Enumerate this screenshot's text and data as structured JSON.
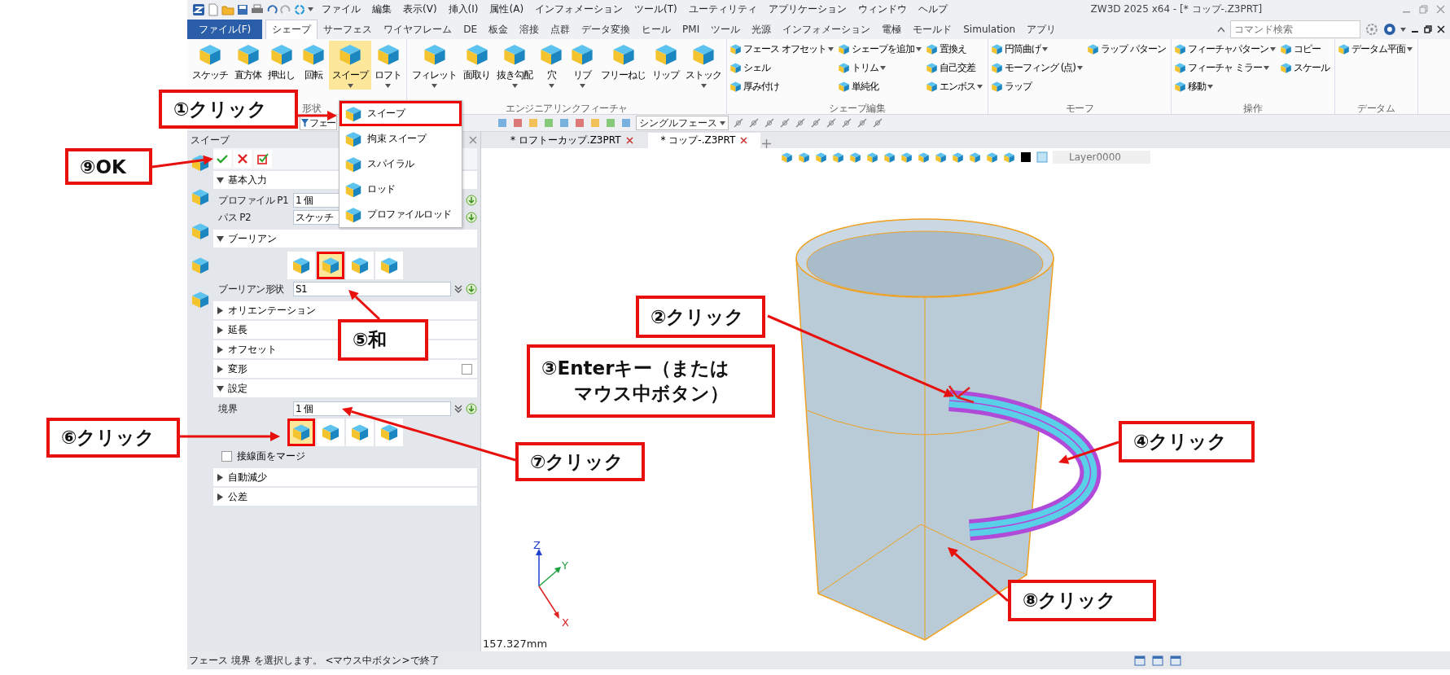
{
  "title_bar": {
    "menu": [
      "ファイル",
      "編集",
      "表示(V)",
      "挿入(I)",
      "属性(A)",
      "インフォメーション",
      "ツール(T)",
      "ユーティリティ",
      "アプリケーション",
      "ウィンドウ",
      "ヘルプ"
    ],
    "title": "ZW3D 2025 x64 - [* コップ-.Z3PRT]"
  },
  "ribbon_tabs": [
    {
      "label": "ファイル(F)",
      "kind": "file",
      "selected": false
    },
    {
      "label": "シェープ",
      "kind": "tab",
      "selected": true
    },
    {
      "label": "サーフェス",
      "kind": "tab",
      "selected": false
    },
    {
      "label": "ワイヤフレーム",
      "kind": "tab",
      "selected": false
    },
    {
      "label": "DE",
      "kind": "tab",
      "selected": false
    },
    {
      "label": "板金",
      "kind": "tab",
      "selected": false
    },
    {
      "label": "溶接",
      "kind": "tab",
      "selected": false
    },
    {
      "label": "点群",
      "kind": "tab",
      "selected": false
    },
    {
      "label": "データ変換",
      "kind": "tab",
      "selected": false
    },
    {
      "label": "ヒール",
      "kind": "tab",
      "selected": false
    },
    {
      "label": "PMI",
      "kind": "tab",
      "selected": false
    },
    {
      "label": "ツール",
      "kind": "tab",
      "selected": false
    },
    {
      "label": "光源",
      "kind": "tab",
      "selected": false
    },
    {
      "label": "インフォメーション",
      "kind": "tab",
      "selected": false
    },
    {
      "label": "電極",
      "kind": "tab",
      "selected": false
    },
    {
      "label": "モールド",
      "kind": "tab",
      "selected": false
    },
    {
      "label": "Simulation",
      "kind": "tab",
      "selected": false
    },
    {
      "label": "アプリ",
      "kind": "tab",
      "selected": false
    }
  ],
  "command_search": {
    "placeholder": "コマンド検索"
  },
  "ribbon_groups": [
    {
      "kind": "large",
      "label": "形状",
      "items": [
        {
          "label": "スケッチ",
          "dropdown": false,
          "selected": false
        },
        {
          "label": "直方体",
          "dropdown": false,
          "selected": false
        },
        {
          "label": "押出し",
          "dropdown": false,
          "selected": false
        },
        {
          "label": "回転",
          "dropdown": false,
          "selected": false
        },
        {
          "label": "スイープ",
          "dropdown": true,
          "selected": true
        },
        {
          "label": "ロフト",
          "dropdown": true,
          "selected": false
        }
      ]
    },
    {
      "kind": "large",
      "label": "エンジニアリンクフィーチャ",
      "items": [
        {
          "label": "フィレット",
          "dropdown": true,
          "selected": false
        },
        {
          "label": "面取り",
          "dropdown": false,
          "selected": false
        },
        {
          "label": "抜き勾配",
          "dropdown": true,
          "selected": false
        },
        {
          "label": "穴",
          "dropdown": true,
          "selected": false
        },
        {
          "label": "リブ",
          "dropdown": true,
          "selected": false
        },
        {
          "label": "フリーねじ",
          "dropdown": false,
          "selected": false
        },
        {
          "label": "リップ",
          "dropdown": false,
          "selected": false
        },
        {
          "label": "ストック",
          "dropdown": true,
          "selected": false
        }
      ]
    },
    {
      "kind": "small",
      "label": "シェープ編集",
      "columns": [
        [
          {
            "label": "フェース オフセット",
            "dropdown": true
          },
          {
            "label": "シェル",
            "dropdown": false
          },
          {
            "label": "厚み付け",
            "dropdown": false
          }
        ],
        [
          {
            "label": "シェープを追加",
            "dropdown": true
          },
          {
            "label": "トリム",
            "dropdown": true
          },
          {
            "label": "単純化",
            "dropdown": false
          }
        ],
        [
          {
            "label": "置換え",
            "dropdown": false
          },
          {
            "label": "自己交差",
            "dropdown": false
          },
          {
            "label": "エンボス",
            "dropdown": true
          }
        ]
      ]
    },
    {
      "kind": "small",
      "label": "モーフ",
      "columns": [
        [
          {
            "label": "円筒曲げ",
            "dropdown": true
          },
          {
            "label": "モーフィング (点)",
            "dropdown": true
          },
          {
            "label": "ラップ",
            "dropdown": false
          }
        ],
        [
          {
            "label": "ラップ パターン",
            "dropdown": false
          }
        ]
      ]
    },
    {
      "kind": "small",
      "label": "操作",
      "columns": [
        [
          {
            "label": "フィーチャパターン",
            "dropdown": true
          },
          {
            "label": "フィーチャ ミラー",
            "dropdown": true
          },
          {
            "label": "移動",
            "dropdown": true
          }
        ],
        [
          {
            "label": "コピー",
            "dropdown": false
          },
          {
            "label": "スケール",
            "dropdown": false
          }
        ]
      ]
    },
    {
      "kind": "small",
      "label": "データム",
      "columns": [
        [
          {
            "label": "データム平面",
            "dropdown": true
          }
        ]
      ]
    }
  ],
  "selection_toolbar": {
    "filter": "フェー",
    "pick_mode": "シングルフェース"
  },
  "panel": {
    "title": "スイープ",
    "sections": [
      {
        "label": "基本入力",
        "expanded": true,
        "rows": [
          {
            "label": "プロファイル P1",
            "value": "1 個"
          },
          {
            "label": "パス P2",
            "value": "スケッチ"
          }
        ]
      },
      {
        "label": "ブーリアン",
        "expanded": true,
        "options": [
          {
            "selected": false,
            "annotated": false
          },
          {
            "selected": true,
            "annotated": true
          },
          {
            "selected": false,
            "annotated": false
          },
          {
            "selected": false,
            "annotated": false
          }
        ],
        "rows": [
          {
            "label": "ブーリアン形状",
            "value": "S1"
          }
        ]
      },
      {
        "label": "オリエンテーション",
        "expanded": false
      },
      {
        "label": "延長",
        "expanded": false
      },
      {
        "label": "オフセット",
        "expanded": false
      },
      {
        "label": "変形",
        "expanded": false,
        "toggle": {
          "checked": false
        }
      },
      {
        "label": "設定",
        "expanded": true,
        "rows": [
          {
            "label": "境界",
            "value": "1 個"
          }
        ],
        "options": [
          {
            "selected": true,
            "annotated": true
          },
          {
            "selected": false,
            "annotated": false
          },
          {
            "selected": false,
            "annotated": false
          },
          {
            "selected": false,
            "annotated": false
          }
        ],
        "check_rows": [
          {
            "label": "接線面をマージ",
            "checked": false
          }
        ]
      },
      {
        "label": "自動減少",
        "expanded": false
      },
      {
        "label": "公差",
        "expanded": false
      }
    ]
  },
  "sweep_menu": {
    "items": [
      {
        "label": "スイープ",
        "annotated": true
      },
      {
        "label": "拘束 スイープ",
        "annotated": false
      },
      {
        "label": "スパイラル",
        "annotated": false
      },
      {
        "label": "ロッド",
        "annotated": false
      },
      {
        "label": "プロファイルロッド",
        "annotated": false
      }
    ]
  },
  "document_tabs": [
    {
      "label": "* ロフトーカップ.Z3PRT",
      "selected": false
    },
    {
      "label": "* コップ-.Z3PRT",
      "selected": true
    }
  ],
  "view_toolbar": {
    "layer": "Layer0000"
  },
  "viewport": {
    "scale": "157.327mm",
    "axes": [
      {
        "label": "Z",
        "kind": "z"
      },
      {
        "label": "Y",
        "kind": "y"
      },
      {
        "label": "X",
        "kind": "x"
      }
    ]
  },
  "status_bar": {
    "text": "フェース 境界 を選択します。 <マウス中ボタン>で終了"
  },
  "callouts": [
    {
      "lines": [
        "①クリック"
      ]
    },
    {
      "lines": [
        "⑨OK"
      ]
    },
    {
      "lines": [
        "⑤和"
      ]
    },
    {
      "lines": [
        "②クリック"
      ]
    },
    {
      "lines": [
        "③Enterキー（または",
        "マウス中ボタン）"
      ]
    },
    {
      "lines": [
        "④クリック"
      ]
    },
    {
      "lines": [
        "⑥クリック"
      ]
    },
    {
      "lines": [
        "⑦クリック"
      ]
    },
    {
      "lines": [
        "⑧クリック"
      ]
    }
  ]
}
